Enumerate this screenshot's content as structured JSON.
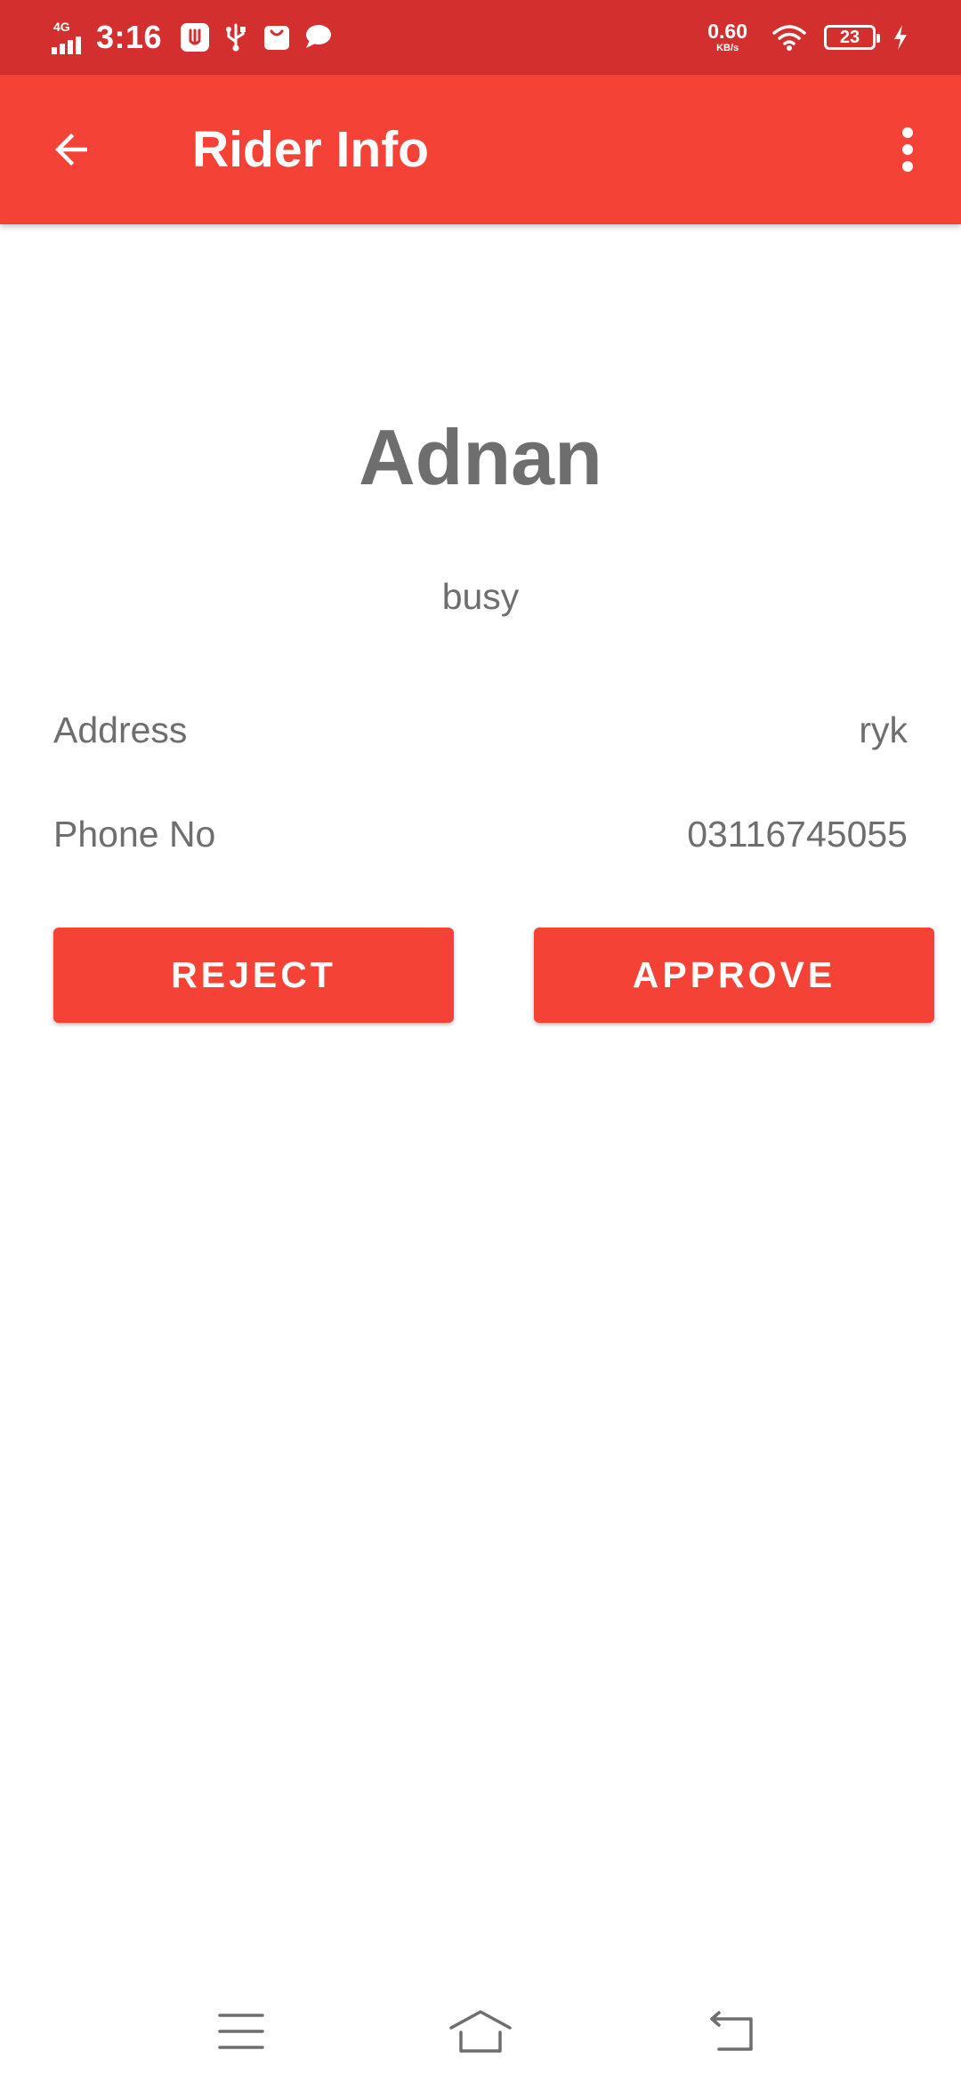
{
  "status_bar": {
    "network_type": "4G",
    "time": "3:16",
    "speed_value": "0.60",
    "speed_unit": "KB/s",
    "battery_level": "23",
    "icons": [
      "signal-icon",
      "usb-debug-icon",
      "usb-icon",
      "shopping-bag-icon",
      "chat-bubble-icon",
      "wifi-icon",
      "battery-icon",
      "charging-icon"
    ]
  },
  "app_bar": {
    "title": "Rider Info",
    "back_icon": "arrow-back-icon",
    "menu_icon": "more-vert-icon"
  },
  "rider": {
    "name": "Adnan",
    "status": "busy",
    "fields": [
      {
        "label": "Address",
        "value": "ryk"
      },
      {
        "label": "Phone No",
        "value": "03116745055"
      }
    ]
  },
  "actions": {
    "reject_label": "REJECT",
    "approve_label": "APPROVE"
  },
  "nav_bar": {
    "icons": [
      "menu-icon",
      "home-icon",
      "back-icon"
    ]
  },
  "colors": {
    "status_bar": "#d32f2f",
    "app_bar": "#f44336",
    "button": "#f44336",
    "text_gray": "#6e6e6e",
    "background": "#ffffff"
  }
}
